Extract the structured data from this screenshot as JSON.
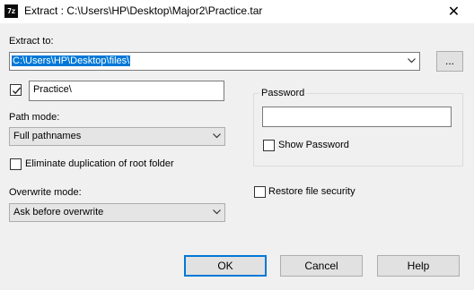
{
  "window": {
    "app_icon_text": "7z",
    "title": "Extract : C:\\Users\\HP\\Desktop\\Major2\\Practice.tar",
    "close_glyph": "✕"
  },
  "extract_to": {
    "label": "Extract to:",
    "value": "C:\\Users\\HP\\Desktop\\files\\",
    "browse_label": "..."
  },
  "subfolder": {
    "checked": true,
    "value": "Practice\\"
  },
  "path_mode": {
    "label": "Path mode:",
    "value": "Full pathnames"
  },
  "eliminate_duplication": {
    "checked": false,
    "label": "Eliminate duplication of root folder"
  },
  "overwrite_mode": {
    "label": "Overwrite mode:",
    "value": "Ask before overwrite"
  },
  "password": {
    "group_label": "Password",
    "value": "",
    "show_password_checked": false,
    "show_password_label": "Show Password"
  },
  "restore_security": {
    "checked": false,
    "label": "Restore file security"
  },
  "buttons": {
    "ok": "OK",
    "cancel": "Cancel",
    "help": "Help"
  }
}
